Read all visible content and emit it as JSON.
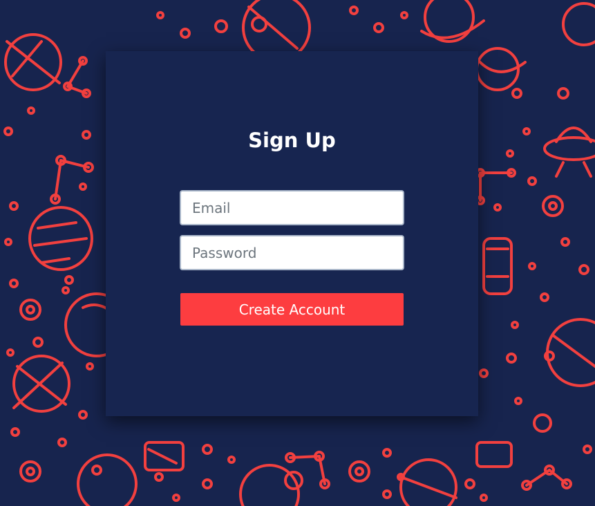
{
  "form": {
    "title": "Sign Up",
    "email_placeholder": "Email",
    "email_value": "",
    "password_placeholder": "Password",
    "password_value": "",
    "submit_label": "Create Account"
  },
  "colors": {
    "background": "#17244e",
    "card": "#172550",
    "pattern_red": "#f2403f",
    "pattern_orange": "#f06a3a",
    "button": "#fd3d40",
    "text": "#ffffff"
  },
  "icons": [
    "planet-icon",
    "satellite-icon",
    "ufo-icon",
    "rocket-icon",
    "constellation-icon",
    "star-dot-icon"
  ]
}
